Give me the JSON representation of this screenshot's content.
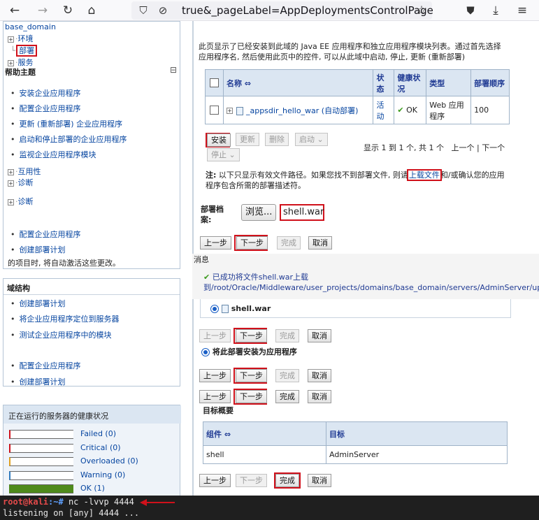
{
  "browser": {
    "url": "true&_pageLabel=AppDeploymentsControlPage",
    "icons": [
      "back-arrow-icon",
      "forward-arrow-icon",
      "reload-icon",
      "home-icon",
      "shield-icon",
      "no-tracking-icon",
      "star-icon",
      "pocket-icon",
      "download-icon",
      "menu-icon"
    ]
  },
  "tree": {
    "root": "base_domain",
    "items": [
      {
        "label": "环境",
        "toggle": "+"
      },
      {
        "label": "部署",
        "toggle": ""
      },
      {
        "label": "服务",
        "toggle": "+"
      }
    ]
  },
  "help": {
    "title": "帮助主题",
    "collapse": "⊟",
    "items": [
      "安装企业应用程序",
      "配置企业应用程序",
      "更新 (重新部署) 企业应用程序",
      "启动和停止部署的企业应用程序",
      "监视企业应用程序模块"
    ],
    "more": [
      {
        "label": "互用性",
        "toggle": "+"
      },
      {
        "label": "诊断",
        "toggle": "+"
      },
      {
        "label": "诊断",
        "toggle": "+"
      }
    ],
    "items2": [
      "配置企业应用程序",
      "创建部署计划"
    ],
    "trailing": "的项目时, 将自动激活这些更改。"
  },
  "domain_structure": {
    "title": "域结构",
    "items": [
      "创建部署计划",
      "将企业应用程序定位到服务器",
      "测试企业应用程序中的模块"
    ],
    "items2": [
      "配置企业应用程序",
      "创建部署计划"
    ]
  },
  "health": {
    "title": "正在运行的服务器的健康状况",
    "rows": [
      {
        "label": "Failed (0)",
        "color": "#d0111b",
        "fill": 0
      },
      {
        "label": "Critical (0)",
        "color": "#d0111b",
        "fill": 0
      },
      {
        "label": "Overloaded (0)",
        "color": "#e0a020",
        "fill": 0
      },
      {
        "label": "Warning (0)",
        "color": "#2f7bbf",
        "fill": 0
      },
      {
        "label": "OK (1)",
        "color": "#4e8a1c",
        "fill": 1
      }
    ]
  },
  "main": {
    "intro": "此页显示了已经安装到此域的 Java EE 应用程序和独立应用程序模块列表。通过首先选择应用程序名, 然后使用此页中的控件, 可以从此域中启动, 停止, 更新 (重新部署)",
    "table": {
      "headers": [
        "名称 ⇔",
        "状态",
        "健康状况",
        "类型",
        "部署顺序"
      ],
      "row": {
        "name": "_appsdir_hello_war (自动部署)",
        "state": "活动",
        "health": "OK",
        "type": "Web 应用程序",
        "order": "100"
      }
    },
    "buttons": {
      "install": "安装",
      "update": "更新",
      "delete": "删除",
      "start": "启动",
      "stop": "停止"
    },
    "pager": "显示 1 到 1 个, 共 1 个",
    "prev": "上一个",
    "sep": "|",
    "next": "下一个",
    "note_prefix": "注:",
    "note_before": " 以下只显示有效文件路径。如果您找不到部署文件, 则请",
    "note_link": "上载文件",
    "note_after": "和/或确认您的应用程序包含所需的部署描述符。",
    "deploy_label": "部署档案:",
    "browse_label": "浏览...",
    "file_value": "shell.war",
    "nav": {
      "back": "上一步",
      "next": "下一步",
      "finish": "完成",
      "cancel": "取消"
    },
    "message_title": "消息",
    "message_text": "已成功将文件shell.war上载到/root/Oracle/Middleware/user_projects/domains/base_domain/servers/AdminServer/upload",
    "selected_file": "shell.war",
    "install_as_app": "将此部署安装为应用程序",
    "summary_title": "目标概要",
    "summary_headers": [
      "组件 ⇔",
      "目标"
    ],
    "summary_row": {
      "component": "shell",
      "target": "AdminServer"
    }
  },
  "terminal": {
    "prompt_user": "root@kali",
    "prompt_path": ":~#",
    "command": " nc -lvvp 4444",
    "output": "listening on [any] 4444 ..."
  }
}
